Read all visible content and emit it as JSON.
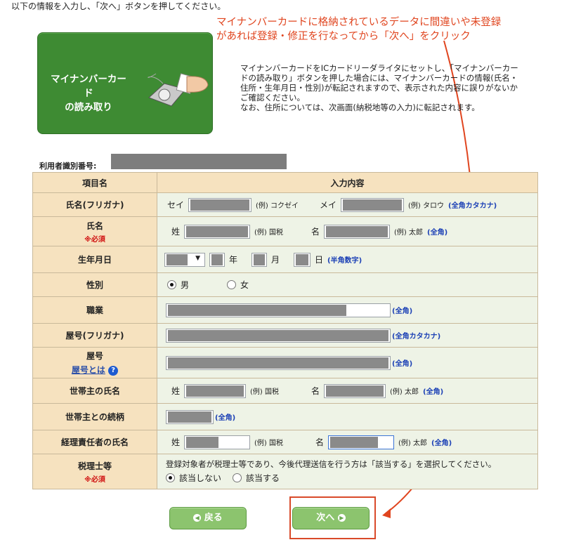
{
  "intro_text": "以下の情報を入力し、「次へ」ボタンを押してください。",
  "annotation": {
    "line1": "マイナンバーカードに格納されているデータに間違いや未登録",
    "line2": "があれば登録・修正を行なってから「次へ」をクリック",
    "color": "#e0451f"
  },
  "card_button": {
    "line1": "マイナンバーカード",
    "line2": "の読み取り"
  },
  "explanation": {
    "p1": "マイナンバーカードをICカードリーダライタにセットし、「マイナンバーカードの読み取り」ボタンを押した場合には、マイナンバーカードの情報(氏名・住所・生年月日・性別)が転記されますので、表示された内容に誤りがないかご確認ください。",
    "p2": "なお、住所については、次画面(納税地等の入力)に転記されます。"
  },
  "user_id_label": "利用者識別番号:",
  "table": {
    "col_item": "項目名",
    "col_input": "入力内容",
    "rows": {
      "kana_name": {
        "label": "氏名(フリガナ)",
        "sei": "セイ",
        "ex1": "(例) コクゼイ",
        "mei": "メイ",
        "ex2": "(例) タロウ",
        "hint": "(全角カタカナ)"
      },
      "name": {
        "label": "氏名",
        "required": "※必須",
        "sei": "姓",
        "ex1": "(例) 国税",
        "mei": "名",
        "ex2": "(例) 太郎",
        "hint": "(全角)"
      },
      "birth": {
        "label": "生年月日",
        "year": "年",
        "month": "月",
        "day": "日",
        "hint": "(半角数字)"
      },
      "gender": {
        "label": "性別",
        "male": "男",
        "female": "女"
      },
      "occupation": {
        "label": "職業",
        "hint": "(全角)"
      },
      "shop_kana": {
        "label": "屋号(フリガナ)",
        "hint": "(全角カタカナ)"
      },
      "shop": {
        "label": "屋号",
        "sub": "屋号とは",
        "hint": "(全角)",
        "help_icon": "question-icon"
      },
      "householder": {
        "label": "世帯主の氏名",
        "sei": "姓",
        "ex1": "(例) 国税",
        "mei": "名",
        "ex2": "(例) 太郎",
        "hint": "(全角)"
      },
      "relation": {
        "label": "世帯主との続柄",
        "hint": "(全角)"
      },
      "manager": {
        "label": "経理責任者の氏名",
        "sei": "姓",
        "ex1": "(例) 国税",
        "mei": "名",
        "ex2": "(例) 太郎",
        "hint": "(全角)"
      },
      "tax_acct": {
        "label": "税理士等",
        "required": "※必須",
        "desc": "登録対象者が税理士等であり、今後代理送信を行う方は「該当する」を選択してください。",
        "opt_no": "該当しない",
        "opt_yes": "該当する"
      }
    }
  },
  "buttons": {
    "back": "戻る",
    "next": "次へ"
  },
  "colors": {
    "header_bg": "#f6e2bf",
    "row_bg": "#eef3e6",
    "button_green": "#8cc46e",
    "card_green": "#3e8b33"
  }
}
